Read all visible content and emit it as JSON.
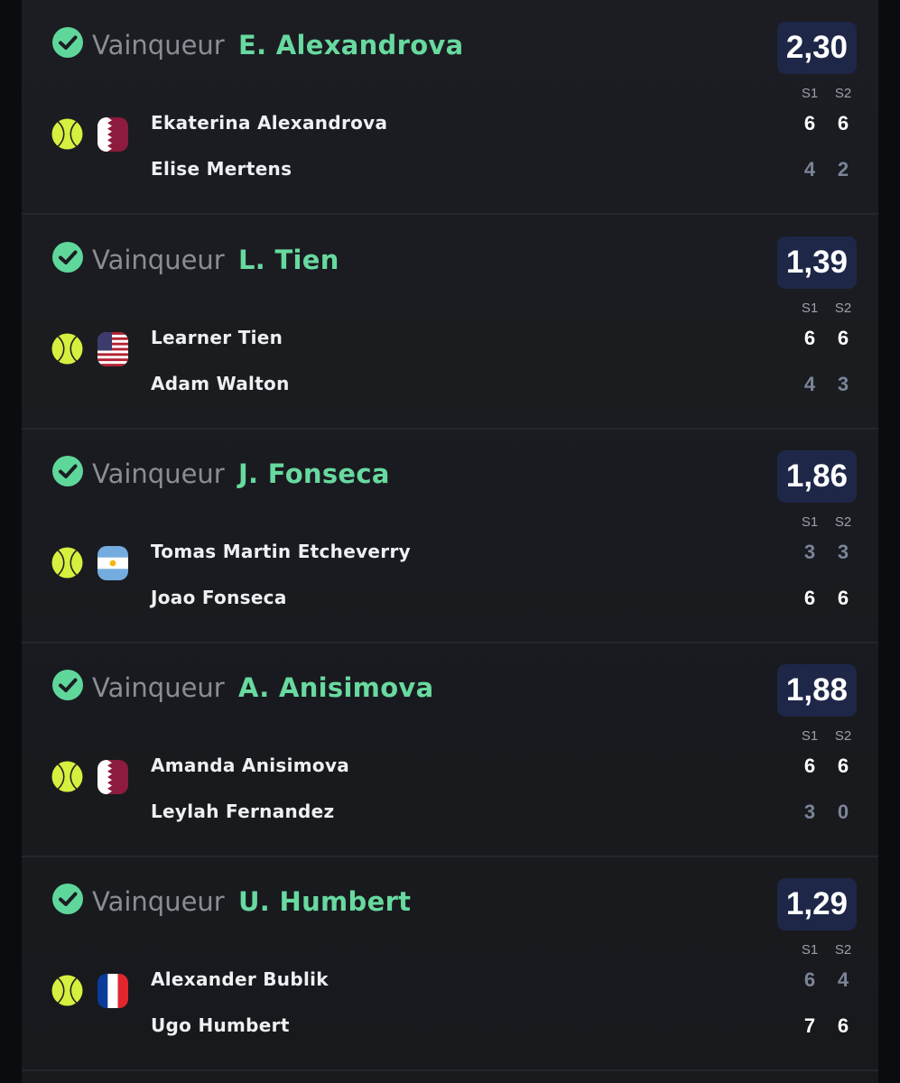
{
  "matches": [
    {
      "result_label": "Vainqueur",
      "winner": "E. Alexandrova",
      "odds": "2,30",
      "set_labels": [
        "S1",
        "S2"
      ],
      "flag": "qatar-flag",
      "players": [
        {
          "name": "Ekaterina Alexandrova",
          "scores": [
            "6",
            "6"
          ],
          "won": true
        },
        {
          "name": "Elise Mertens",
          "scores": [
            "4",
            "2"
          ],
          "won": false
        }
      ]
    },
    {
      "result_label": "Vainqueur",
      "winner": "L. Tien",
      "odds": "1,39",
      "set_labels": [
        "S1",
        "S2"
      ],
      "flag": "usa-flag",
      "players": [
        {
          "name": "Learner Tien",
          "scores": [
            "6",
            "6"
          ],
          "won": true
        },
        {
          "name": "Adam Walton",
          "scores": [
            "4",
            "3"
          ],
          "won": false
        }
      ]
    },
    {
      "result_label": "Vainqueur",
      "winner": "J. Fonseca",
      "odds": "1,86",
      "set_labels": [
        "S1",
        "S2"
      ],
      "flag": "argentina-flag",
      "players": [
        {
          "name": "Tomas Martin Etcheverry",
          "scores": [
            "3",
            "3"
          ],
          "won": false
        },
        {
          "name": "Joao Fonseca",
          "scores": [
            "6",
            "6"
          ],
          "won": true
        }
      ]
    },
    {
      "result_label": "Vainqueur",
      "winner": "A. Anisimova",
      "odds": "1,88",
      "set_labels": [
        "S1",
        "S2"
      ],
      "flag": "qatar-flag",
      "players": [
        {
          "name": "Amanda Anisimova",
          "scores": [
            "6",
            "6"
          ],
          "won": true
        },
        {
          "name": "Leylah Fernandez",
          "scores": [
            "3",
            "0"
          ],
          "won": false
        }
      ]
    },
    {
      "result_label": "Vainqueur",
      "winner": "U. Humbert",
      "odds": "1,29",
      "set_labels": [
        "S1",
        "S2"
      ],
      "flag": "france-flag",
      "players": [
        {
          "name": "Alexander Bublik",
          "scores": [
            "6",
            "4"
          ],
          "won": false
        },
        {
          "name": "Ugo Humbert",
          "scores": [
            "7",
            "6"
          ],
          "won": true
        }
      ]
    }
  ],
  "colors": {
    "accent_green": "#68d99f",
    "odds_bg": "#1e2748",
    "panel_bg": "#1b1d22",
    "loser_score": "#7c8498"
  }
}
